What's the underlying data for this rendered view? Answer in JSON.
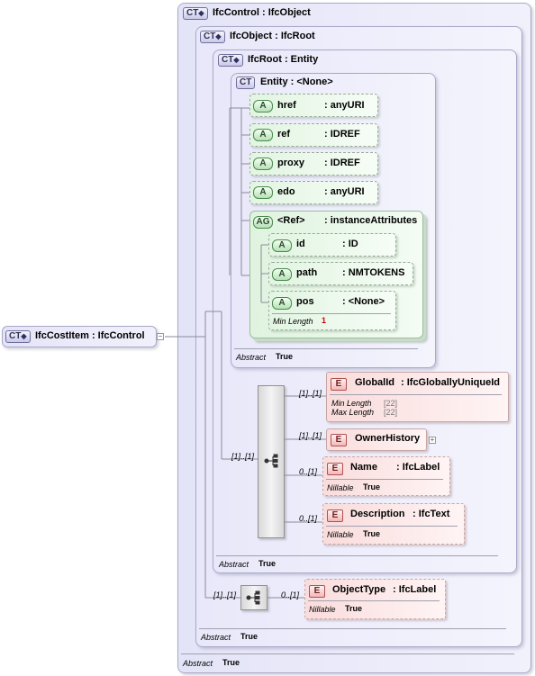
{
  "root": {
    "badge": "CT",
    "title": "IfcCostItem : IfcControl"
  },
  "ifccontrol": {
    "badge": "CT",
    "title": "IfcControl : IfcObject",
    "abstract_label": "Abstract",
    "abstract_value": "True"
  },
  "ifcobject": {
    "badge": "CT",
    "title": "IfcObject : IfcRoot",
    "abstract_label": "Abstract",
    "abstract_value": "True"
  },
  "ifcroot": {
    "badge": "CT",
    "title": "IfcRoot   : Entity",
    "abstract_label": "Abstract",
    "abstract_value": "True"
  },
  "entity": {
    "badge": "CT",
    "title": "Entity     : <None>",
    "abstract_label": "Abstract",
    "abstract_value": "True",
    "attributes": [
      {
        "badge": "A",
        "name": "href",
        "type": ": anyURI"
      },
      {
        "badge": "A",
        "name": "ref",
        "type": ": IDREF"
      },
      {
        "badge": "A",
        "name": "proxy",
        "type": ": IDREF"
      },
      {
        "badge": "A",
        "name": "edo",
        "type": ": anyURI"
      }
    ],
    "attribute_group": {
      "badge": "AG",
      "name": "<Ref>",
      "type": ": instanceAttributes",
      "attributes": [
        {
          "badge": "A",
          "name": "id",
          "type": ": ID"
        },
        {
          "badge": "A",
          "name": "path",
          "type": ": NMTOKENS"
        },
        {
          "badge": "A",
          "name": "pos",
          "type": ": <None>",
          "facet_label": "Min Length",
          "facet_value": "1"
        }
      ]
    }
  },
  "root_sequence": {
    "occurrence": "[1]..[1]",
    "elements": [
      {
        "badge": "E",
        "name": "GlobalId",
        "type": ": IfcGloballyUniqueId",
        "occurrence": "[1]..[1]",
        "facets": [
          {
            "label": "Min Length",
            "value": "[22]"
          },
          {
            "label": "Max Length",
            "value": "[22]"
          }
        ]
      },
      {
        "badge": "E",
        "name": "OwnerHistory",
        "occurrence": "[1]..[1]"
      },
      {
        "badge": "E",
        "name": "Name",
        "type": ": IfcLabel",
        "occurrence": "0..[1]",
        "facet_label": "Nillable",
        "facet_value": "True"
      },
      {
        "badge": "E",
        "name": "Description",
        "type": ": IfcText",
        "occurrence": "0..[1]",
        "facet_label": "Nillable",
        "facet_value": "True"
      }
    ]
  },
  "object_sequence": {
    "occurrence": "[1]..[1]",
    "elements": [
      {
        "badge": "E",
        "name": "ObjectType",
        "type": ": IfcLabel",
        "occurrence": "0..[1]",
        "facet_label": "Nillable",
        "facet_value": "True"
      }
    ]
  },
  "icons": {
    "type_badge": "ct-badge-icon",
    "expand": "plus-icon",
    "collapse": "minus-icon",
    "sequence": "sequence-icon"
  }
}
